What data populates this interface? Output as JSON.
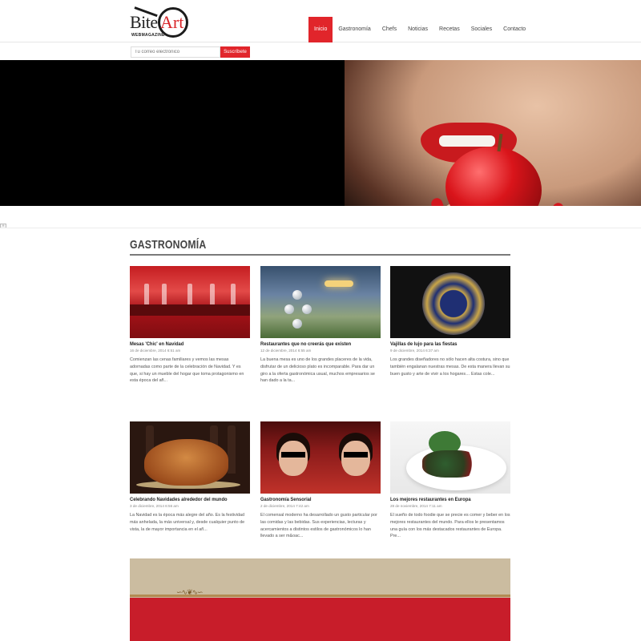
{
  "header": {
    "logo": {
      "word1": "Bite",
      "word2": "Art",
      "tagline": "WEBMAGAZINE"
    },
    "nav": [
      {
        "label": "Inicio",
        "active": true
      },
      {
        "label": "Gastronomía"
      },
      {
        "label": "Chefs"
      },
      {
        "label": "Noticias"
      },
      {
        "label": "Recetas"
      },
      {
        "label": "Sociales"
      },
      {
        "label": "Contacto"
      }
    ]
  },
  "subscribe": {
    "placeholder": "Tu correo electrónico",
    "button_label": "Suscríbete"
  },
  "hero": {
    "slider_control_icon": "slider-arrow-icon",
    "slider_control": "»"
  },
  "section": {
    "title": "GASTRONOMÍA"
  },
  "articles": [
    {
      "title": "Mesas 'Chic' en Navidad",
      "date": "16 de diciembre, 2014 6:51 am",
      "excerpt": "Comienzan las cenas familiares y vemos las mesas adornadas como parte de la celebración de Navidad. Y es que, si hay un mueble del hogar que toma protagonismo en esta época del añ..."
    },
    {
      "title": "Restaurantes que no creerás que existen",
      "date": "12 de diciembre, 2014 6:55 am",
      "excerpt": "La buena mesa es uno de los grandes placeres de la vida, disfrutar de un delicioso plato es incomparable. Para dar un giro a la oferta gastronómica usual, muchos empresarios se han dado a la ta..."
    },
    {
      "title": "Vajillas de lujo para las fiestas",
      "date": "9 de diciembre, 2014 6:37 am",
      "excerpt": "Los grandes diseñadores no sólo hacen alta costura, sino que también engalanan nuestras mesas. De esta manera llevan su buen gusto y arte de vivir a los hogares… Estas cole..."
    },
    {
      "title": "Celebrando Navidades alrededor del mundo",
      "date": "3 de diciembre, 2014 6:56 am",
      "excerpt": "La Navidad es la época más alegre del año. Es la festividad más anhelada, la más universal y, desde cualquier punto de vista, la de mayor importancia en el añ..."
    },
    {
      "title": "Gastronomía Sensorial",
      "date": "2 de diciembre, 2014 7:42 am",
      "excerpt": "El comensal moderno ha desarrollado un gusto particular por las comidas y las bebidas. Sus experiencias, lecturas y acercamientos a distintos estilos de gastronómicos lo han llevado a ser m&oac..."
    },
    {
      "title": "Los mejores restaurantes en Europa",
      "date": "28 de noviembre, 2014 7:11 am",
      "excerpt": "El sueño de todo foodie que se precie es comer y beber en los mejores restaurantes del mundo. Para ellos le presentamos una guía con los más destacados restaurantes de Europa. Pre..."
    }
  ],
  "banner": {
    "ornament": "∽∿❦∿∽"
  }
}
